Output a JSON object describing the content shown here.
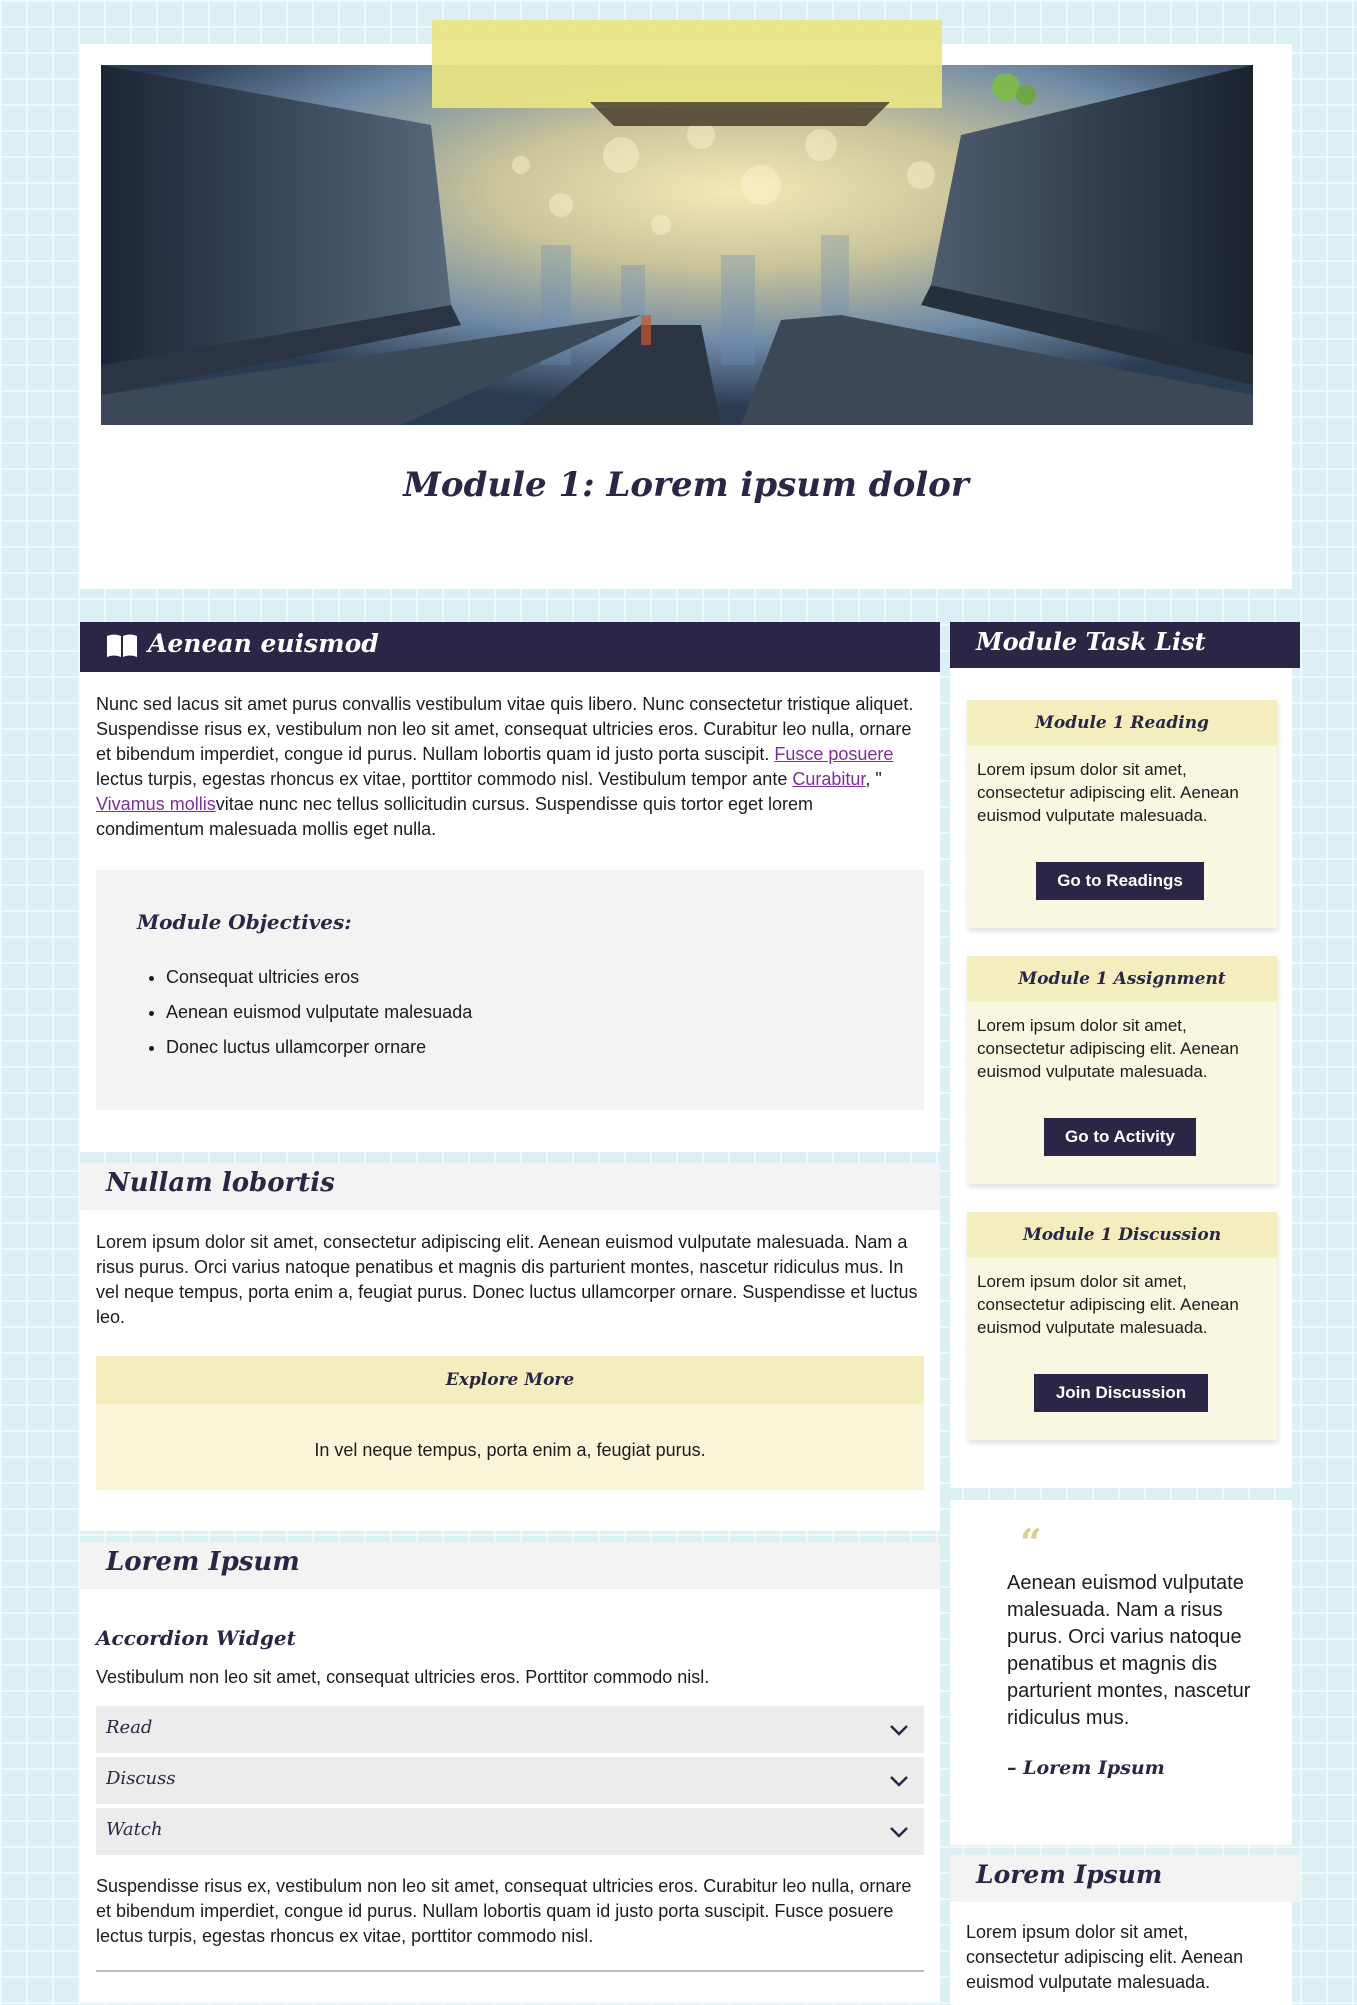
{
  "header": {
    "hero_image": "photograph looking up between wooden planks toward blurred city lights",
    "title": "Module 1: Lorem ipsum dolor"
  },
  "section1": {
    "title": "Aenean euismod",
    "icon": "book-open-icon",
    "text_a": "Nunc sed lacus sit amet purus convallis vestibulum vitae quis libero. Nunc consectetur tristique aliquet. Suspendisse risus ex, vestibulum non leo sit amet, consequat ultricies eros. Curabitur leo nulla, ornare et bibendum imperdiet, congue id purus. Nullam lobortis quam id justo porta suscipit. ",
    "link1": "Fusce posuere",
    "text_b": " lectus turpis, egestas rhoncus ex vitae, porttitor commodo nisl. Vestibulum tempor ante ",
    "link2": "Curabitur",
    "text_c": ", \" ",
    "link3": "Vivamus mollis",
    "text_d": "vitae nunc nec tellus sollicitudin cursus. Suspendisse quis tortor eget lorem condimentum malesuada mollis eget nulla.",
    "objectives_title": "Module Objectives:",
    "objectives": [
      "Consequat ultricies eros",
      "Aenean euismod vulputate malesuada",
      "Donec luctus ullamcorper ornare"
    ]
  },
  "section2": {
    "title": "Nullam lobortis",
    "text": "Lorem ipsum dolor sit amet, consectetur adipiscing elit. Aenean euismod vulputate malesuada. Nam a risus purus. Orci varius natoque penatibus et magnis dis parturient montes, nascetur ridiculus mus. In vel neque tempus, porta enim a, feugiat purus. Donec luctus ullamcorper ornare. Suspendisse et luctus leo.",
    "explore_title": "Explore More",
    "explore_text": "In vel neque tempus, porta enim a, feugiat purus."
  },
  "section3": {
    "title": "Lorem Ipsum",
    "accordion_title": "Accordion Widget",
    "accordion_desc": "Vestibulum non leo sit amet, consequat ultricies eros. Porttitor commodo nisl.",
    "accordion_items": [
      "Read",
      "Discuss",
      "Watch"
    ],
    "text": "Suspendisse risus ex, vestibulum non leo sit amet, consequat ultricies eros. Curabitur leo nulla, ornare et bibendum imperdiet, congue id purus. Nullam lobortis quam id justo porta suscipit. Fusce posuere lectus turpis, egestas rhoncus ex vitae, porttitor commodo nisl."
  },
  "sidebar": {
    "task_list_title": "Module Task List",
    "tasks": [
      {
        "title": "Module 1 Reading",
        "text": "Lorem ipsum dolor sit amet, consectetur adipiscing elit. Aenean euismod vulputate malesuada.",
        "button": "Go to Readings"
      },
      {
        "title": "Module 1 Assignment",
        "text": "Lorem ipsum dolor sit amet, consectetur adipiscing elit. Aenean euismod vulputate malesuada.",
        "button": "Go to Activity"
      },
      {
        "title": "Module 1 Discussion",
        "text": "Lorem ipsum dolor sit amet, consectetur adipiscing elit. Aenean euismod vulputate malesuada.",
        "button": "Join Discussion"
      }
    ],
    "quote": {
      "mark": "“",
      "text": "Aenean euismod vulputate malesuada. Nam a risus purus. Orci varius natoque penatibus et magnis dis parturient montes, nascetur ridiculus mus.",
      "author": "– Lorem Ipsum"
    },
    "bottom": {
      "title": "Lorem Ipsum",
      "text": "Lorem ipsum dolor sit amet, consectetur adipiscing elit. Aenean euismod vulputate malesuada."
    }
  },
  "colors": {
    "dark_band": "#2b2645",
    "page_background": "#dcf0f4",
    "note_yellow": "#f9f6e2",
    "note_header": "#f4edbe",
    "link": "#7b2ea0"
  }
}
